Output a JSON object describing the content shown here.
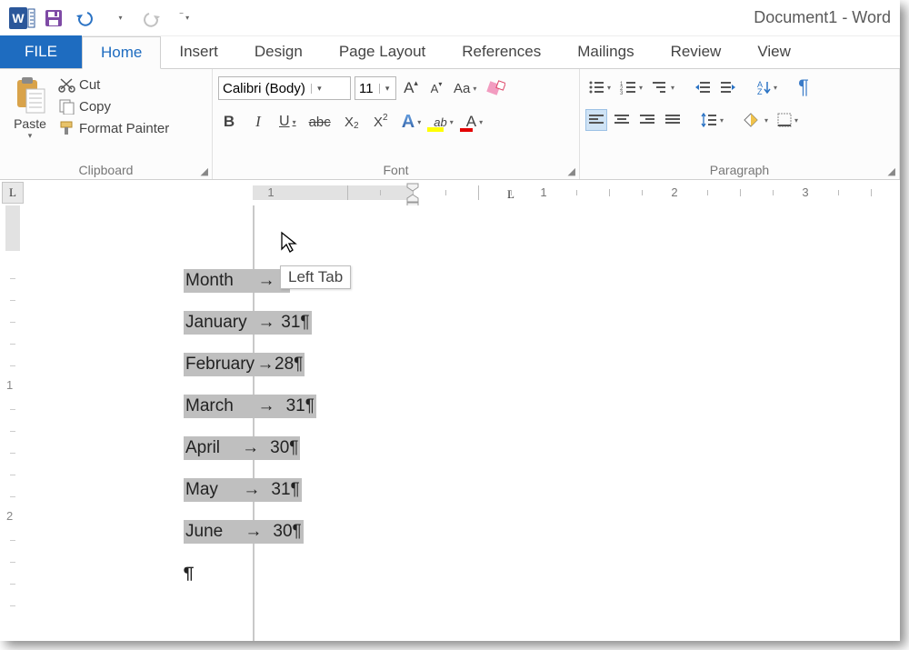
{
  "title": "Document1 - Word",
  "tabs": {
    "file": "FILE",
    "home": "Home",
    "insert": "Insert",
    "design": "Design",
    "pagelayout": "Page Layout",
    "references": "References",
    "mailings": "Mailings",
    "review": "Review",
    "view": "View"
  },
  "clipboard": {
    "paste": "Paste",
    "cut": "Cut",
    "copy": "Copy",
    "format_painter": "Format Painter",
    "group": "Clipboard"
  },
  "font": {
    "name": "Calibri (Body)",
    "size": "11",
    "group": "Font"
  },
  "paragraph": {
    "group": "Paragraph"
  },
  "ruler": {
    "n1": "1",
    "n2": "2",
    "n3": "3",
    "left_margin_num": "1"
  },
  "tooltip": "Left Tab",
  "doc": {
    "rows": [
      {
        "c1": "Month",
        "c2": ""
      },
      {
        "c1": "January",
        "c2": "31"
      },
      {
        "c1": "February",
        "c2": "28"
      },
      {
        "c1": "March",
        "c2": "31"
      },
      {
        "c1": "April",
        "c2": "30"
      },
      {
        "c1": "May",
        "c2": "31"
      },
      {
        "c1": "June",
        "c2": "30"
      }
    ]
  },
  "vruler": {
    "n1": "1",
    "n2": "2"
  }
}
